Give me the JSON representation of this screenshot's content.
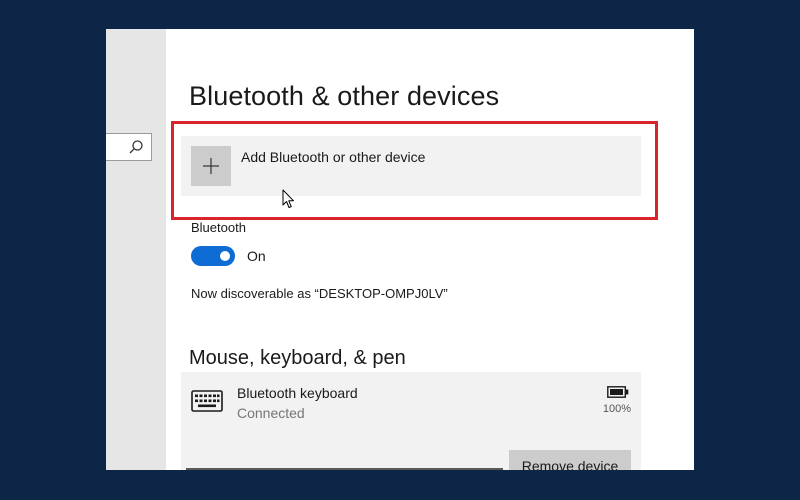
{
  "page": {
    "title": "Bluetooth & other devices"
  },
  "search": {
    "icon": "search-icon"
  },
  "add_device": {
    "label": "Add Bluetooth or other device",
    "icon": "plus-icon"
  },
  "bluetooth": {
    "section_label": "Bluetooth",
    "toggle_state": "On",
    "toggle_on": true,
    "discoverable_text": "Now discoverable as “DESKTOP-OMPJ0LV”"
  },
  "mouse_keyboard_pen": {
    "heading": "Mouse, keyboard, & pen",
    "devices": [
      {
        "name": "Bluetooth keyboard",
        "status": "Connected",
        "battery": "100%",
        "icon": "keyboard-icon",
        "remove_label": "Remove device"
      }
    ]
  },
  "colors": {
    "background": "#0d2648",
    "accent": "#0f6cd4",
    "highlight": "#d9252a"
  }
}
